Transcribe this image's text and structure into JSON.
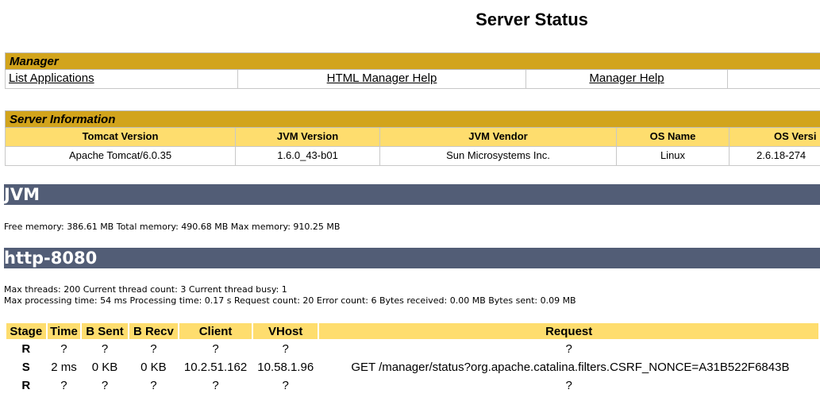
{
  "page_title": "Server Status",
  "manager": {
    "title": "Manager",
    "links": [
      "List Applications",
      "HTML Manager Help",
      "Manager Help",
      ""
    ]
  },
  "server_info": {
    "title": "Server Information",
    "headers": [
      "Tomcat Version",
      "JVM Version",
      "JVM Vendor",
      "OS Name",
      "OS Versi"
    ],
    "values": [
      "Apache Tomcat/6.0.35",
      "1.6.0_43-b01",
      "Sun Microsystems Inc.",
      "Linux",
      "2.6.18-274"
    ]
  },
  "jvm": {
    "title": "JVM",
    "memory": "Free memory: 386.61 MB Total memory: 490.68 MB Max memory: 910.25 MB"
  },
  "connector": {
    "title": "http-8080",
    "threads": "Max threads: 200 Current thread count: 3 Current thread busy: 1",
    "processing": "Max processing time: 54 ms Processing time: 0.17 s Request count: 20 Error count: 6 Bytes received: 0.00 MB Bytes sent: 0.09 MB",
    "table": {
      "headers": [
        "Stage",
        "Time",
        "B Sent",
        "B Recv",
        "Client",
        "VHost",
        "Request"
      ],
      "rows": [
        [
          "R",
          "?",
          "?",
          "?",
          "?",
          "?",
          "?"
        ],
        [
          "S",
          "2 ms",
          "0 KB",
          "0 KB",
          "10.2.51.162",
          "10.58.1.96",
          "GET /manager/status?org.apache.catalina.filters.CSRF_NONCE=A31B522F6843B"
        ],
        [
          "R",
          "?",
          "?",
          "?",
          "?",
          "?",
          "?"
        ]
      ]
    }
  }
}
